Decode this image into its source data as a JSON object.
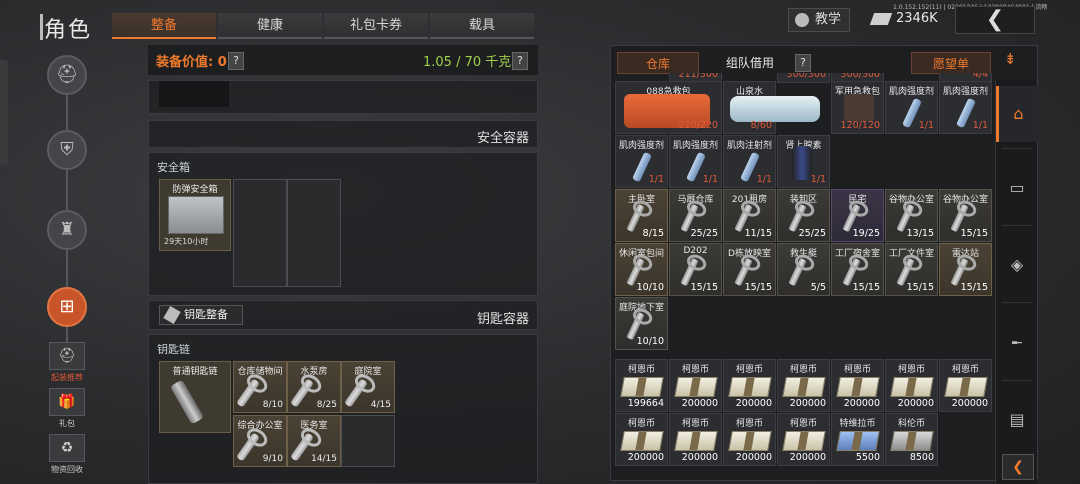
{
  "header": {
    "title": "角色",
    "tabs": [
      "整备",
      "健康",
      "礼包卡券",
      "载具"
    ],
    "active_tab": 0,
    "teach_label": "教学",
    "money": "2346K",
    "build_info": "1.0.152.152(11) | 02201346 | 123928464901 | 流畅",
    "back_icon": "chevron-left-icon"
  },
  "left_nav": {
    "circle_icons": [
      "helmet-icon",
      "armor-vest-icon",
      "backpack-icon",
      "toolbox-icon"
    ],
    "active_index": 3,
    "side_buttons": [
      {
        "icon": "helmet-icon",
        "label": "起装推荐",
        "highlight": true
      },
      {
        "icon": "gift-icon",
        "label": "礼包",
        "highlight": false
      },
      {
        "icon": "recycle-icon",
        "label": "物资回收",
        "highlight": false
      }
    ]
  },
  "equip": {
    "value_label": "装备价值: 0",
    "weight": "1.05 / 70 千克",
    "safe_container_title": "安全容器",
    "safe_box_label": "安全箱",
    "safe_box_item_name": "防弹安全箱",
    "safe_box_item_time": "29天10小时",
    "key_prep_button": "钥匙整备",
    "key_container_title": "钥匙容器",
    "keychain_label": "钥匙链",
    "keychain_item_name": "普通钥匙链",
    "keys": [
      {
        "name": "仓库储物间",
        "count": "8/10"
      },
      {
        "name": "水泵房",
        "count": "8/25"
      },
      {
        "name": "庭院室",
        "count": "4/15"
      },
      {
        "name": "综合办公室",
        "count": "9/10"
      },
      {
        "name": "医务室",
        "count": "14/15"
      }
    ]
  },
  "storage": {
    "tabs": [
      "仓库",
      "组队借用"
    ],
    "wishlist_label": "愿望单",
    "top_partial_counts": [
      "211/300",
      "300/300",
      "300/300",
      "4/4"
    ],
    "items": [
      {
        "name": "088急救包",
        "count": "220/220",
        "color": "red",
        "type": "medkit"
      },
      {
        "name": "山泉水",
        "count": "8/60",
        "color": "red",
        "type": "water"
      },
      {
        "name": "军用急救包",
        "count": "120/120",
        "color": "red",
        "type": "medkit2"
      },
      {
        "name": "肌肉强度剂",
        "count": "1/1",
        "color": "red",
        "type": "vial"
      },
      {
        "name": "肌肉强度剂",
        "count": "1/1",
        "color": "red",
        "type": "vial"
      },
      {
        "name": "肌肉强度剂",
        "count": "1/1",
        "color": "red",
        "type": "vial"
      },
      {
        "name": "肌肉强度剂",
        "count": "1/1",
        "color": "red",
        "type": "vial"
      },
      {
        "name": "肌肉注射剂",
        "count": "1/1",
        "color": "red",
        "type": "vial"
      },
      {
        "name": "肾上腺素",
        "count": "1/1",
        "color": "red",
        "type": "can"
      }
    ],
    "keys": [
      {
        "name": "主卧室",
        "count": "8/15",
        "bg": "gold"
      },
      {
        "name": "马厩仓库",
        "count": "25/25",
        "bg": "key-bg"
      },
      {
        "name": "201租房",
        "count": "11/15",
        "bg": "key-bg"
      },
      {
        "name": "装卸区",
        "count": "25/25",
        "bg": "key-bg"
      },
      {
        "name": "民宅",
        "count": "19/25",
        "bg": "purple"
      },
      {
        "name": "谷物办公室",
        "count": "13/15",
        "bg": "key-bg"
      },
      {
        "name": "谷物办公室",
        "count": "15/15",
        "bg": "key-bg"
      },
      {
        "name": "休闲室包间",
        "count": "10/10",
        "bg": "gold"
      },
      {
        "name": "D202",
        "count": "15/15",
        "bg": "key-bg"
      },
      {
        "name": "D栋放映室",
        "count": "15/15",
        "bg": "key-bg"
      },
      {
        "name": "救生艇",
        "count": "5/5",
        "bg": "key-bg"
      },
      {
        "name": "工厂宿舍室",
        "count": "15/15",
        "bg": "key-bg"
      },
      {
        "name": "工厂文件室",
        "count": "15/15",
        "bg": "key-bg"
      },
      {
        "name": "雷达站",
        "count": "15/15",
        "bg": "gold"
      },
      {
        "name": "庭院地下室",
        "count": "10/10",
        "bg": "key-bg"
      }
    ],
    "currency": [
      {
        "name": "柯恩币",
        "count": "199664",
        "kind": "normal"
      },
      {
        "name": "柯恩币",
        "count": "200000",
        "kind": "normal"
      },
      {
        "name": "柯恩币",
        "count": "200000",
        "kind": "normal"
      },
      {
        "name": "柯恩币",
        "count": "200000",
        "kind": "normal"
      },
      {
        "name": "柯恩币",
        "count": "200000",
        "kind": "normal"
      },
      {
        "name": "柯恩币",
        "count": "200000",
        "kind": "normal"
      },
      {
        "name": "柯恩币",
        "count": "200000",
        "kind": "normal"
      },
      {
        "name": "柯恩币",
        "count": "200000",
        "kind": "normal"
      },
      {
        "name": "柯恩币",
        "count": "200000",
        "kind": "normal"
      },
      {
        "name": "柯恩币",
        "count": "200000",
        "kind": "normal"
      },
      {
        "name": "柯恩币",
        "count": "200000",
        "kind": "normal"
      },
      {
        "name": "特维拉币",
        "count": "5500",
        "kind": "blue"
      },
      {
        "name": "科伦币",
        "count": "8500",
        "kind": "gray"
      }
    ]
  },
  "right_nav": {
    "icons": [
      "home-icon",
      "ammo-box-icon",
      "crate-icon",
      "rifle-icon",
      "case-icon"
    ],
    "active_index": 0,
    "collapse_icon": "chevron-left-icon",
    "sort_icon": "sort-icon"
  },
  "colors": {
    "accent": "#f07a2c",
    "weight_green": "#9ed04a",
    "count_red": "#e05a3a"
  }
}
